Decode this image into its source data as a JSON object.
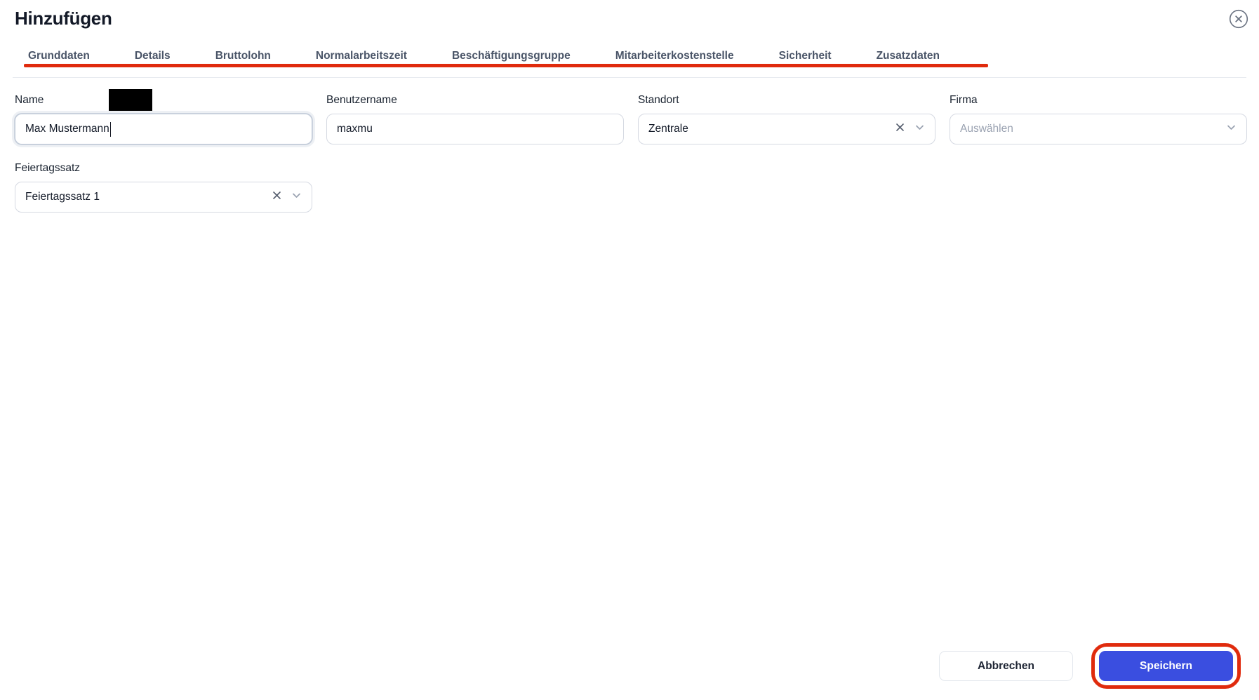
{
  "dialog": {
    "title": "Hinzufügen"
  },
  "tabs": [
    {
      "label": "Grunddaten",
      "active": true
    },
    {
      "label": "Details",
      "active": false
    },
    {
      "label": "Bruttolohn",
      "active": false
    },
    {
      "label": "Normalarbeitszeit",
      "active": false
    },
    {
      "label": "Beschäftigungsgruppe",
      "active": false
    },
    {
      "label": "Mitarbeiterkostenstelle",
      "active": false
    },
    {
      "label": "Sicherheit",
      "active": false
    },
    {
      "label": "Zusatzdaten",
      "active": false
    }
  ],
  "form": {
    "name": {
      "label": "Name",
      "value": "Max Mustermann"
    },
    "benutzername": {
      "label": "Benutzername",
      "value": "maxmu"
    },
    "standort": {
      "label": "Standort",
      "value": "Zentrale"
    },
    "firma": {
      "label": "Firma",
      "placeholder": "Auswählen"
    },
    "feiertagssatz": {
      "label": "Feiertagssatz",
      "value": "Feiertagssatz 1"
    }
  },
  "footer": {
    "cancel_label": "Abbrechen",
    "save_label": "Speichern"
  },
  "colors": {
    "primary_blue": "#3a4ee0",
    "annotation_red": "#e02b0d"
  }
}
